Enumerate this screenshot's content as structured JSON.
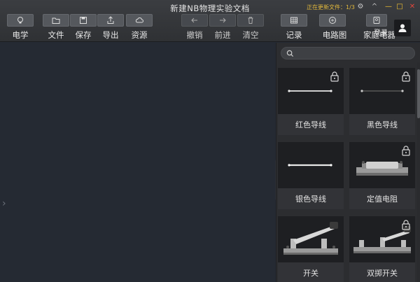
{
  "window": {
    "title": "新建NB物理实验文档",
    "update_status": "正在更新文件：1/3",
    "controls": [
      "⚙",
      "^",
      "—",
      "□",
      "✕"
    ]
  },
  "toolbar": {
    "electric": "电学",
    "file": "文件",
    "save": "保存",
    "export": "导出",
    "resources": "资源",
    "undo": "撤销",
    "redo": "前进",
    "clear": "清空",
    "record": "记录",
    "circuit": "电路图",
    "home_appliance": "家庭电器",
    "login": "登录"
  },
  "panel": {
    "items": [
      {
        "label": "红色导线",
        "locked": true
      },
      {
        "label": "黑色导线",
        "locked": true
      },
      {
        "label": "银色导线",
        "locked": false
      },
      {
        "label": "定值电阻",
        "locked": true
      },
      {
        "label": "开关",
        "locked": false
      },
      {
        "label": "双掷开关",
        "locked": true
      }
    ]
  },
  "colors": {
    "accent_yellow": "#e3b93c",
    "close_red": "#e0463c",
    "canvas_bg": "#252a33",
    "panel_bg": "#2c2d30"
  }
}
